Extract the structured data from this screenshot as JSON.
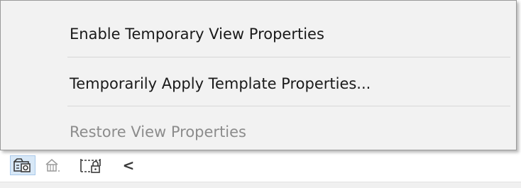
{
  "menu": {
    "items": [
      {
        "label": "Enable Temporary View Properties",
        "enabled": true
      },
      {
        "label": "Temporarily Apply Template Properties...",
        "enabled": true
      },
      {
        "label": "Restore View Properties",
        "enabled": false
      }
    ]
  },
  "statusbar": {
    "icons": [
      {
        "name": "temporary-view-properties-icon",
        "active": true
      },
      {
        "name": "reveal-hidden-elements-icon",
        "active": false
      },
      {
        "name": "crop-view-lock-icon",
        "active": false
      },
      {
        "name": "collapse-arrow-icon",
        "glyph": "<",
        "active": false
      }
    ]
  },
  "colors": {
    "menu_background": "#f2f2f2",
    "menu_border": "#9a9a9a",
    "text": "#1a1a1a",
    "disabled_text": "#8c8c8c",
    "active_icon_bg": "#d8e8f7"
  }
}
